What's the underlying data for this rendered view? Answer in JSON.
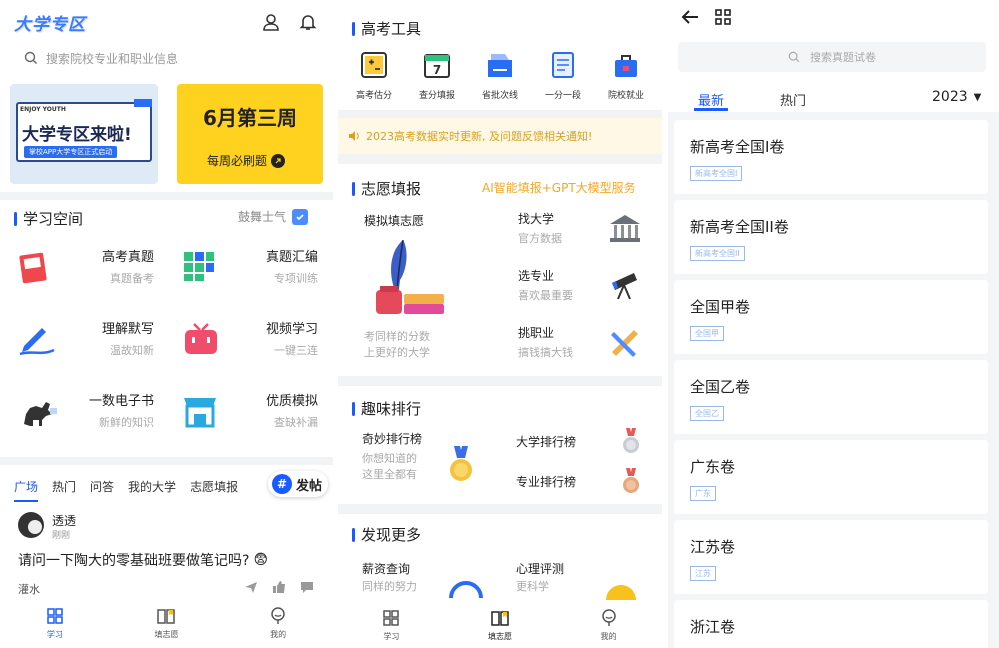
{
  "p1": {
    "logo": "大学专区",
    "search_placeholder": "搜索院校专业和职业信息",
    "banner1": {
      "tag": "ENJOY YOUTH",
      "title": "大学专区来啦!",
      "sub": "掌校APP大学专区正式启动"
    },
    "banner2": {
      "title": "6月第三周",
      "sub": "每周必刷题"
    },
    "study_title": "学习空间",
    "study_right": "鼓舞士气",
    "tiles": [
      {
        "title": "高考真题",
        "sub": "真题备考",
        "icon": "exam-paper-icon"
      },
      {
        "title": "真题汇编",
        "sub": "专项训练",
        "icon": "grid-blocks-icon"
      },
      {
        "title": "理解默写",
        "sub": "温故知新",
        "icon": "pen-icon"
      },
      {
        "title": "视频学习",
        "sub": "一键三连",
        "icon": "tv-icon"
      },
      {
        "title": "一数电子书",
        "sub": "新鲜的知识",
        "icon": "dinosaur-icon"
      },
      {
        "title": "优质模拟",
        "sub": "查缺补漏",
        "icon": "shop-icon"
      }
    ],
    "tabs": [
      "广场",
      "热门",
      "问答",
      "我的大学",
      "志愿填报"
    ],
    "post_button": "发帖",
    "post": {
      "user": "透透",
      "time": "刚刚",
      "text": "请问一下陶大的零基础班要做笔记吗?",
      "tag": "灌水"
    },
    "nav": [
      "学习",
      "填志愿",
      "我的"
    ]
  },
  "p2": {
    "tools_title": "高考工具",
    "tools": [
      {
        "label": "高考估分",
        "icon": "calculator-icon"
      },
      {
        "label": "查分填报",
        "icon": "calendar-icon"
      },
      {
        "label": "省批次线",
        "icon": "folder-chart-icon"
      },
      {
        "label": "一分一段",
        "icon": "document-icon"
      },
      {
        "label": "院校就业",
        "icon": "briefcase-icon"
      }
    ],
    "notice": "2023高考数据实时更新, 及问题反馈相关通知!",
    "volunteer_title": "志愿填报",
    "volunteer_ai": "AI智能填报+GPT大模型服务",
    "mock": {
      "title": "模拟填志愿",
      "sub1": "考同样的分数",
      "sub2": "上更好的大学"
    },
    "finds": [
      {
        "title": "找大学",
        "sub": "官方数据",
        "icon": "university-icon"
      },
      {
        "title": "选专业",
        "sub": "喜欢最重要",
        "icon": "telescope-icon"
      },
      {
        "title": "挑职业",
        "sub": "搞钱搞大钱",
        "icon": "tools-icon"
      }
    ],
    "rank_title": "趣味排行",
    "rank_left": {
      "title": "奇妙排行榜",
      "sub1": "你想知道的",
      "sub2": "这里全都有"
    },
    "ranks": [
      "大学排行榜",
      "专业排行榜"
    ],
    "discover_title": "发现更多",
    "discover": [
      {
        "title": "薪资查询",
        "sub": "同样的努力"
      },
      {
        "title": "心理评测",
        "sub": "更科学"
      }
    ],
    "nav": [
      "学习",
      "填志愿",
      "我的"
    ]
  },
  "p3": {
    "search_placeholder": "搜索真题试卷",
    "tabs": [
      "最新",
      "热门"
    ],
    "year": "2023",
    "papers": [
      {
        "title": "新高考全国I卷",
        "tag": "新高考全国I"
      },
      {
        "title": "新高考全国II卷",
        "tag": "新高考全国II"
      },
      {
        "title": "全国甲卷",
        "tag": "全国甲"
      },
      {
        "title": "全国乙卷",
        "tag": "全国乙"
      },
      {
        "title": "广东卷",
        "tag": "广东"
      },
      {
        "title": "江苏卷",
        "tag": "江苏"
      },
      {
        "title": "浙江卷",
        "tag": ""
      }
    ]
  },
  "colors": {
    "accent": "#1a5bff",
    "yellow": "#ffd21f",
    "orange": "#f5a623"
  }
}
